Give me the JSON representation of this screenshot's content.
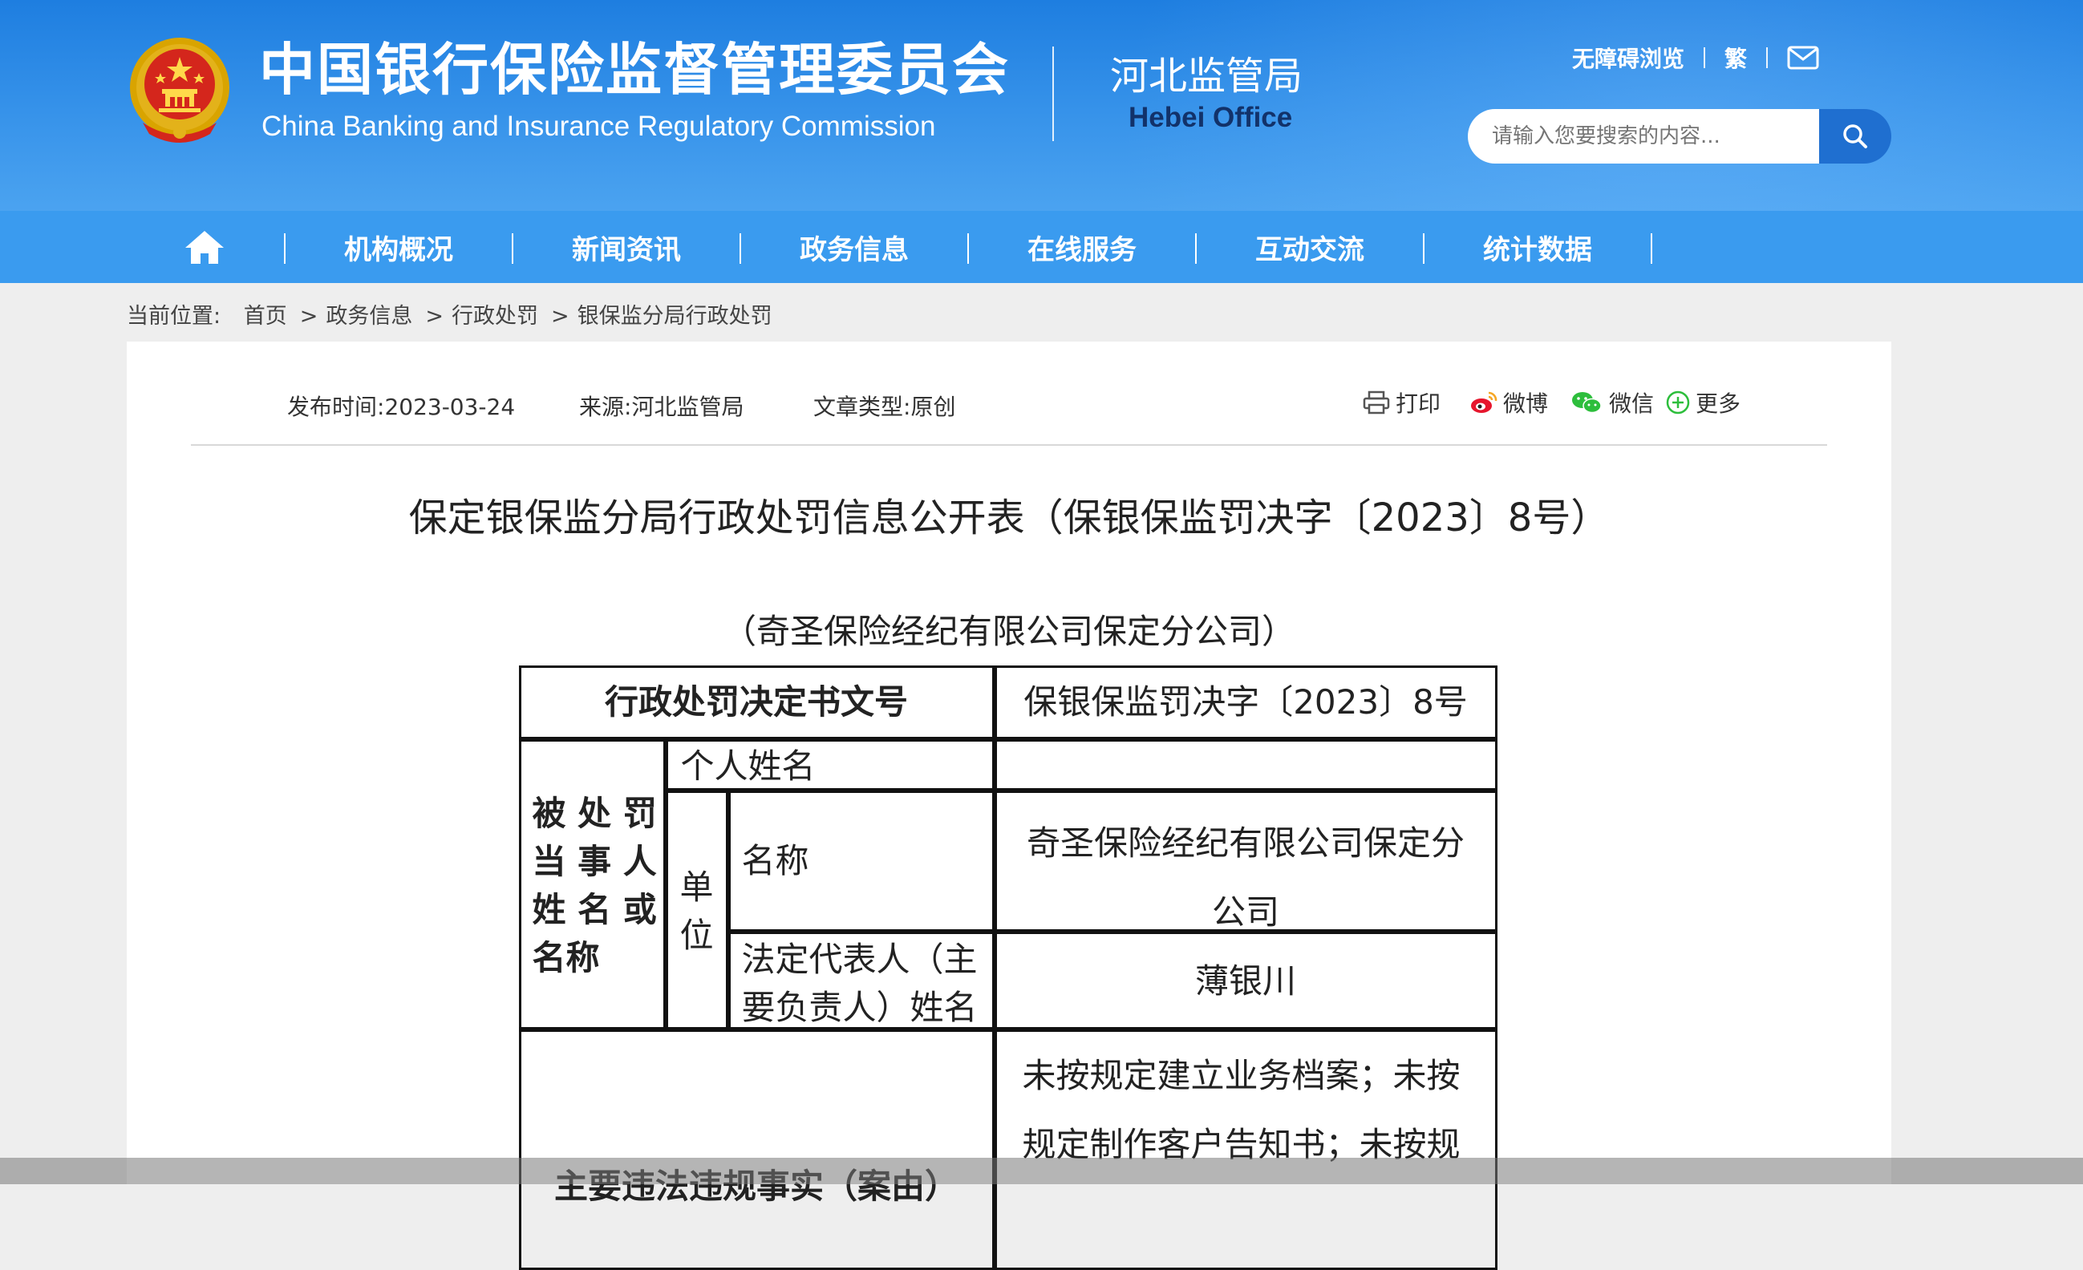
{
  "header": {
    "org_name_cn": "中国银行保险监督管理委员会",
    "org_name_en": "China Banking and Insurance Regulatory Commission",
    "office_cn": "河北监管局",
    "office_en": "Hebei Office",
    "accessibility_link": "无障碍浏览",
    "traditional_link": "繁",
    "search_placeholder": "请输入您要搜索的内容..."
  },
  "nav": {
    "items": [
      "机构概况",
      "新闻资讯",
      "政务信息",
      "在线服务",
      "互动交流",
      "统计数据"
    ]
  },
  "breadcrumb": {
    "prefix": "当前位置:",
    "items": [
      "首页",
      "政务信息",
      "行政处罚",
      "银保监分局行政处罚"
    ]
  },
  "article": {
    "publish_label": "发布时间:",
    "publish_date": "2023-03-24",
    "source_label": "来源:",
    "source": "河北监管局",
    "type_label": "文章类型:",
    "type": "原创",
    "share": {
      "print": "打印",
      "weibo": "微博",
      "wechat": "微信",
      "more": "更多"
    },
    "title": "保定银保监分局行政处罚信息公开表（保银保监罚决字〔2023〕8号）",
    "subtitle": "（奇圣保险经纪有限公司保定分公司）"
  },
  "table": {
    "decision_no_label": "行政处罚决定书文号",
    "decision_no_value": "保银保监罚决字〔2023〕8号",
    "party_label_lines": [
      "被 处 罚",
      "当 事 人",
      "姓 名 或",
      "名称"
    ],
    "individual_name_label": "个人姓名",
    "individual_name_value": "",
    "unit_label_lines": [
      "单",
      "位"
    ],
    "unit_name_label": "名称",
    "unit_name_value_lines": [
      "奇圣保险经纪有限公司保定分",
      "公司"
    ],
    "legal_rep_label_lines": [
      "法定代表人（主",
      "要负责人）姓名"
    ],
    "legal_rep_value": "薄银川",
    "facts_label": "主要违法违规事实（案由）",
    "facts_value_lines": [
      "未按规定建立业务档案；未按",
      "规定制作客户告知书；未按规"
    ]
  }
}
